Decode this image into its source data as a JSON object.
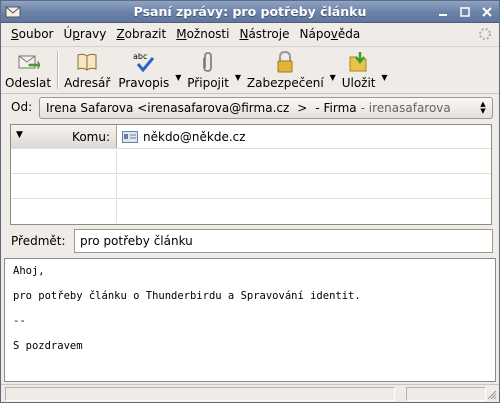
{
  "window": {
    "title": "Psaní zprávy: pro potřeby článku"
  },
  "menubar": [
    {
      "label": "Soubor",
      "accel": "S"
    },
    {
      "label": "Úpravy",
      "accel": "p"
    },
    {
      "label": "Zobrazit",
      "accel": "Z"
    },
    {
      "label": "Možnosti",
      "accel": "M"
    },
    {
      "label": "Nástroje",
      "accel": "N"
    },
    {
      "label": "Nápověda",
      "accel": "v"
    }
  ],
  "toolbar": {
    "send_label": "Odeslat",
    "address_book_label": "Adresář",
    "spelling_label": "Pravopis",
    "attach_label": "Připojit",
    "security_label": "Zabezpečení",
    "save_label": "Uložit"
  },
  "from": {
    "label": "Od:",
    "identity": "Irena Safarova <irenasafarova@firma.cz",
    "separator": ">",
    "account": "- Firma",
    "account_user": "- irenasafarova"
  },
  "recipients": [
    {
      "type": "Komu:",
      "address": "někdo@někde.cz"
    },
    {
      "type": "",
      "address": ""
    },
    {
      "type": "",
      "address": ""
    },
    {
      "type": "",
      "address": ""
    }
  ],
  "subject": {
    "label": "Předmět:",
    "value": "pro potřeby článku"
  },
  "body": {
    "lines": [
      "Ahoj,",
      "pro potřeby článku o Thunderbirdu a Spravování identit.",
      "--",
      "S pozdravem"
    ]
  },
  "colors": {
    "titlebar": "#6a82a8",
    "window_bg": "#efebe7"
  }
}
